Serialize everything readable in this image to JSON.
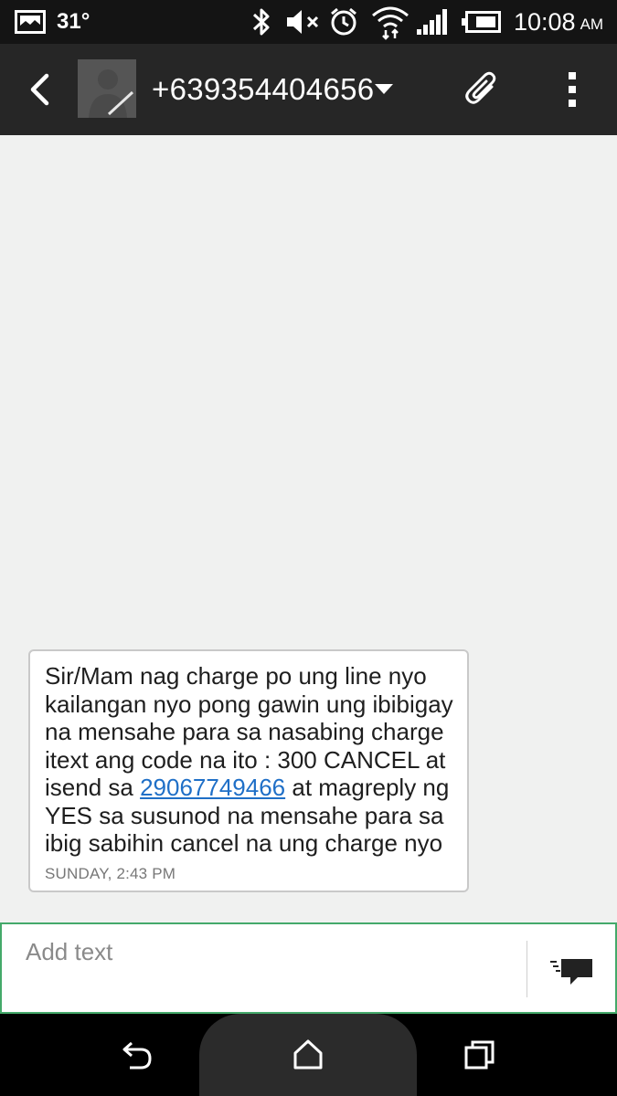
{
  "status_bar": {
    "temperature": "31°",
    "time": "10:08",
    "ampm": "AM"
  },
  "app_bar": {
    "contact": "+639354404656"
  },
  "message": {
    "text_before_link": "Sir/Mam nag charge po ung line nyo kailangan nyo pong gawin ung ibibigay na mensahe para sa nasabing charge itext ang code na ito : 300 CANCEL at isend sa ",
    "link_text": "29067749466",
    "text_after_link": " at magreply ng YES sa susunod na mensahe para sa ibig sabihin cancel na ung charge nyo",
    "timestamp": "SUNDAY, 2:43 PM"
  },
  "composer": {
    "placeholder": "Add text",
    "value": ""
  },
  "colors": {
    "accent": "#44a96a",
    "link": "#1f6fc7",
    "app_bar": "#262626",
    "status_bar": "#141414"
  },
  "icons": {
    "status": [
      "gallery-icon",
      "bluetooth-icon",
      "mute-icon",
      "alarm-icon",
      "wifi-icon",
      "signal-icon",
      "battery-icon"
    ],
    "app_bar": [
      "back-icon",
      "avatar",
      "dropdown-icon",
      "attach-icon",
      "overflow-menu-icon"
    ],
    "composer": [
      "send-icon"
    ],
    "nav": [
      "nav-back-icon",
      "nav-home-icon",
      "nav-recents-icon"
    ]
  }
}
